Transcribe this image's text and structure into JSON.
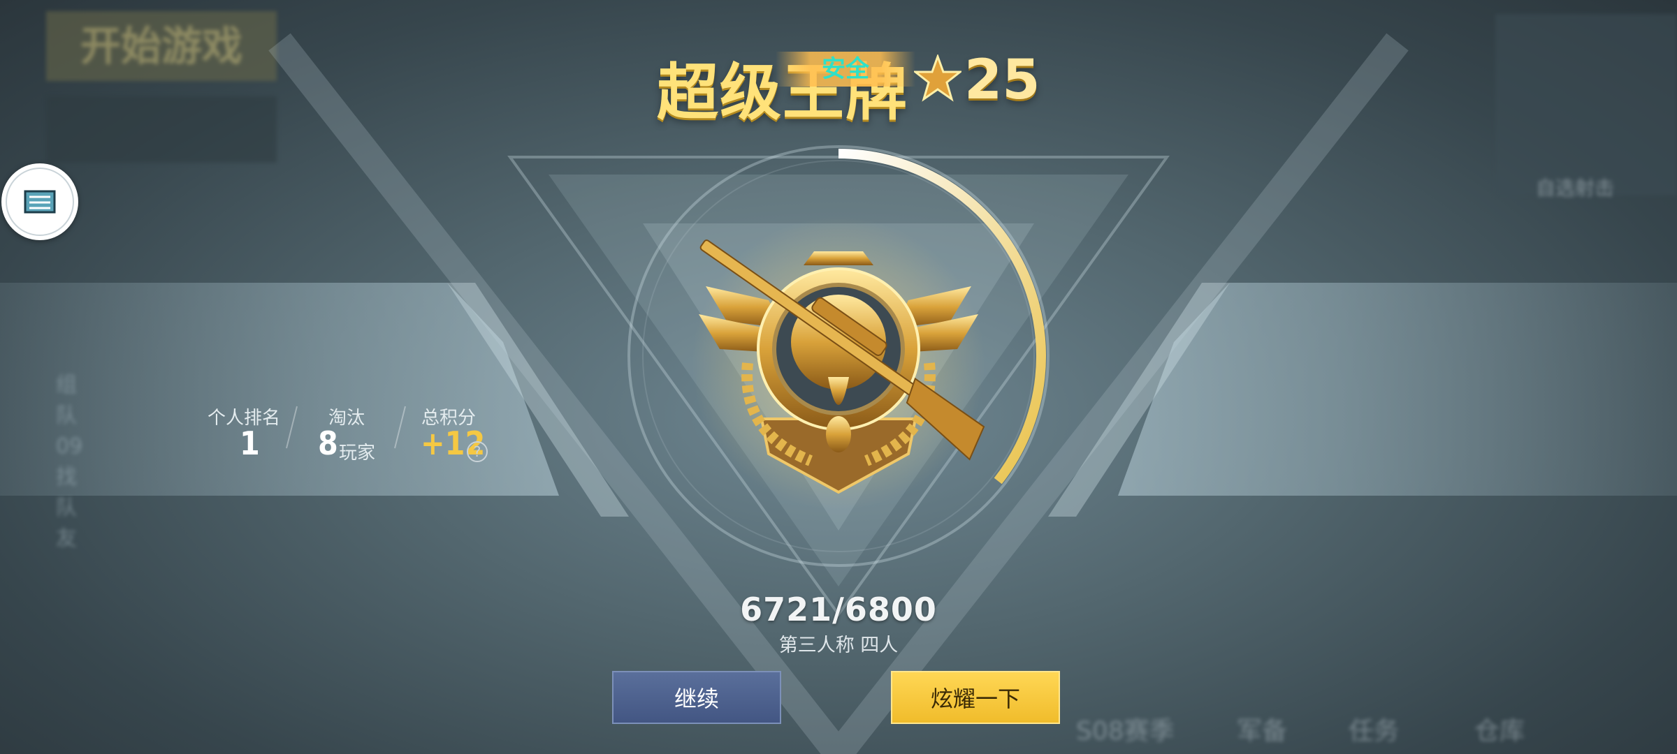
{
  "header": {
    "rank_title": "超级王牌",
    "star_count": "25",
    "overlay_tag": "安全"
  },
  "stats": {
    "rank_label": "个人排名",
    "rank_value": "1",
    "kills_label": "淘汰",
    "kills_value": "8",
    "kills_unit": "玩家",
    "score_label": "总积分",
    "score_value": "+12",
    "help_symbol": "?"
  },
  "progress": {
    "points_text": "6721/6800",
    "current": 6721,
    "max": 6800,
    "mode_text": "第三人称 四人"
  },
  "buttons": {
    "continue_label": "继续",
    "share_label": "炫耀一下"
  },
  "background": {
    "start_game": "开始游戏",
    "side_left": "组队 09 找队友",
    "right_label": "自选射击",
    "bottom_items": [
      "S08赛季",
      "军备",
      "任务",
      "仓库"
    ]
  },
  "colors": {
    "gold": "#f5c843",
    "continue_button": "#4b5f8e",
    "share_button": "#f7c93c"
  },
  "icons": {
    "star": "star-icon",
    "badge": "ace-sniper-badge-icon",
    "help": "question-mark-icon",
    "widget": "floating-assistant-icon"
  }
}
